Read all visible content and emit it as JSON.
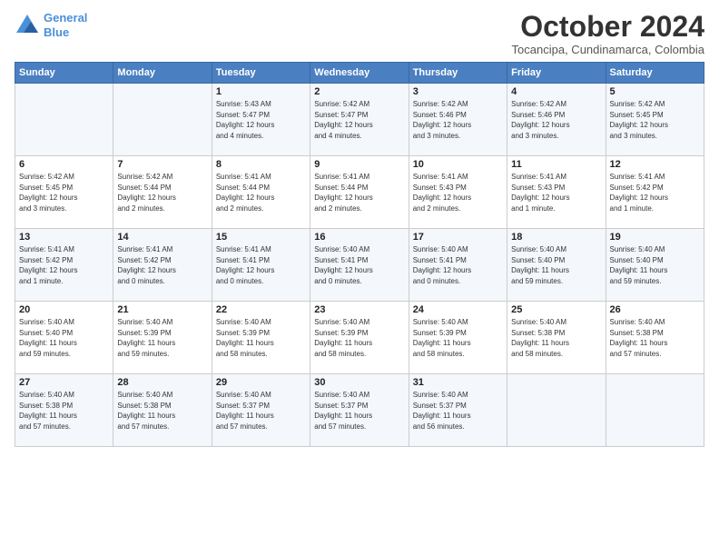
{
  "header": {
    "logo_line1": "General",
    "logo_line2": "Blue",
    "month_title": "October 2024",
    "location": "Tocancipa, Cundinamarca, Colombia"
  },
  "days_of_week": [
    "Sunday",
    "Monday",
    "Tuesday",
    "Wednesday",
    "Thursday",
    "Friday",
    "Saturday"
  ],
  "weeks": [
    [
      {
        "day": "",
        "info": ""
      },
      {
        "day": "",
        "info": ""
      },
      {
        "day": "1",
        "info": "Sunrise: 5:43 AM\nSunset: 5:47 PM\nDaylight: 12 hours\nand 4 minutes."
      },
      {
        "day": "2",
        "info": "Sunrise: 5:42 AM\nSunset: 5:47 PM\nDaylight: 12 hours\nand 4 minutes."
      },
      {
        "day": "3",
        "info": "Sunrise: 5:42 AM\nSunset: 5:46 PM\nDaylight: 12 hours\nand 3 minutes."
      },
      {
        "day": "4",
        "info": "Sunrise: 5:42 AM\nSunset: 5:46 PM\nDaylight: 12 hours\nand 3 minutes."
      },
      {
        "day": "5",
        "info": "Sunrise: 5:42 AM\nSunset: 5:45 PM\nDaylight: 12 hours\nand 3 minutes."
      }
    ],
    [
      {
        "day": "6",
        "info": "Sunrise: 5:42 AM\nSunset: 5:45 PM\nDaylight: 12 hours\nand 3 minutes."
      },
      {
        "day": "7",
        "info": "Sunrise: 5:42 AM\nSunset: 5:44 PM\nDaylight: 12 hours\nand 2 minutes."
      },
      {
        "day": "8",
        "info": "Sunrise: 5:41 AM\nSunset: 5:44 PM\nDaylight: 12 hours\nand 2 minutes."
      },
      {
        "day": "9",
        "info": "Sunrise: 5:41 AM\nSunset: 5:44 PM\nDaylight: 12 hours\nand 2 minutes."
      },
      {
        "day": "10",
        "info": "Sunrise: 5:41 AM\nSunset: 5:43 PM\nDaylight: 12 hours\nand 2 minutes."
      },
      {
        "day": "11",
        "info": "Sunrise: 5:41 AM\nSunset: 5:43 PM\nDaylight: 12 hours\nand 1 minute."
      },
      {
        "day": "12",
        "info": "Sunrise: 5:41 AM\nSunset: 5:42 PM\nDaylight: 12 hours\nand 1 minute."
      }
    ],
    [
      {
        "day": "13",
        "info": "Sunrise: 5:41 AM\nSunset: 5:42 PM\nDaylight: 12 hours\nand 1 minute."
      },
      {
        "day": "14",
        "info": "Sunrise: 5:41 AM\nSunset: 5:42 PM\nDaylight: 12 hours\nand 0 minutes."
      },
      {
        "day": "15",
        "info": "Sunrise: 5:41 AM\nSunset: 5:41 PM\nDaylight: 12 hours\nand 0 minutes."
      },
      {
        "day": "16",
        "info": "Sunrise: 5:40 AM\nSunset: 5:41 PM\nDaylight: 12 hours\nand 0 minutes."
      },
      {
        "day": "17",
        "info": "Sunrise: 5:40 AM\nSunset: 5:41 PM\nDaylight: 12 hours\nand 0 minutes."
      },
      {
        "day": "18",
        "info": "Sunrise: 5:40 AM\nSunset: 5:40 PM\nDaylight: 11 hours\nand 59 minutes."
      },
      {
        "day": "19",
        "info": "Sunrise: 5:40 AM\nSunset: 5:40 PM\nDaylight: 11 hours\nand 59 minutes."
      }
    ],
    [
      {
        "day": "20",
        "info": "Sunrise: 5:40 AM\nSunset: 5:40 PM\nDaylight: 11 hours\nand 59 minutes."
      },
      {
        "day": "21",
        "info": "Sunrise: 5:40 AM\nSunset: 5:39 PM\nDaylight: 11 hours\nand 59 minutes."
      },
      {
        "day": "22",
        "info": "Sunrise: 5:40 AM\nSunset: 5:39 PM\nDaylight: 11 hours\nand 58 minutes."
      },
      {
        "day": "23",
        "info": "Sunrise: 5:40 AM\nSunset: 5:39 PM\nDaylight: 11 hours\nand 58 minutes."
      },
      {
        "day": "24",
        "info": "Sunrise: 5:40 AM\nSunset: 5:39 PM\nDaylight: 11 hours\nand 58 minutes."
      },
      {
        "day": "25",
        "info": "Sunrise: 5:40 AM\nSunset: 5:38 PM\nDaylight: 11 hours\nand 58 minutes."
      },
      {
        "day": "26",
        "info": "Sunrise: 5:40 AM\nSunset: 5:38 PM\nDaylight: 11 hours\nand 57 minutes."
      }
    ],
    [
      {
        "day": "27",
        "info": "Sunrise: 5:40 AM\nSunset: 5:38 PM\nDaylight: 11 hours\nand 57 minutes."
      },
      {
        "day": "28",
        "info": "Sunrise: 5:40 AM\nSunset: 5:38 PM\nDaylight: 11 hours\nand 57 minutes."
      },
      {
        "day": "29",
        "info": "Sunrise: 5:40 AM\nSunset: 5:37 PM\nDaylight: 11 hours\nand 57 minutes."
      },
      {
        "day": "30",
        "info": "Sunrise: 5:40 AM\nSunset: 5:37 PM\nDaylight: 11 hours\nand 57 minutes."
      },
      {
        "day": "31",
        "info": "Sunrise: 5:40 AM\nSunset: 5:37 PM\nDaylight: 11 hours\nand 56 minutes."
      },
      {
        "day": "",
        "info": ""
      },
      {
        "day": "",
        "info": ""
      }
    ]
  ]
}
